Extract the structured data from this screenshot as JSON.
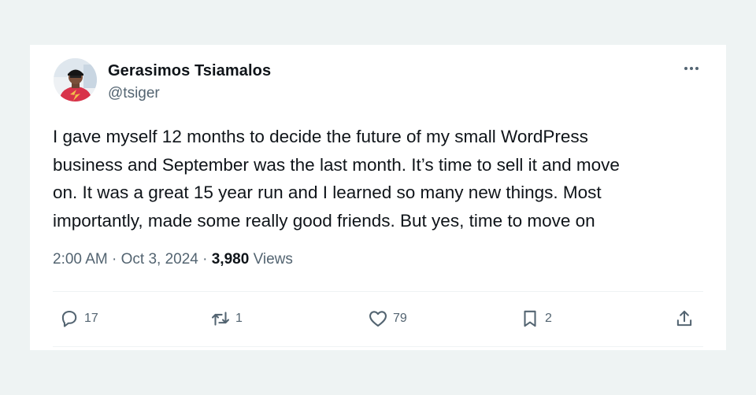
{
  "tweet": {
    "author_name": "Gerasimos Tsiamalos",
    "author_handle": "@tsiger",
    "text": "I gave myself 12 months to decide the future of my small WordPress\nbusiness and September was the last month.  It’s time to sell it and move\non. It was a great 15 year run and I learned so many new things. Most\nimportantly, made some really good friends. But yes, time to move on",
    "time": "2:00 AM",
    "date": "Oct 3, 2024",
    "separator": "·",
    "views_count": "3,980",
    "views_label": "Views"
  },
  "actions": {
    "replies": "17",
    "retweets": "1",
    "likes": "79",
    "bookmarks": "2"
  },
  "icons": {
    "more": "more-icon",
    "reply": "reply-icon",
    "retweet": "retweet-icon",
    "like": "heart-icon",
    "bookmark": "bookmark-icon",
    "share": "share-icon"
  },
  "colors": {
    "background": "#eef3f3",
    "card": "#ffffff",
    "text_primary": "#0f1419",
    "text_secondary": "#536471"
  }
}
